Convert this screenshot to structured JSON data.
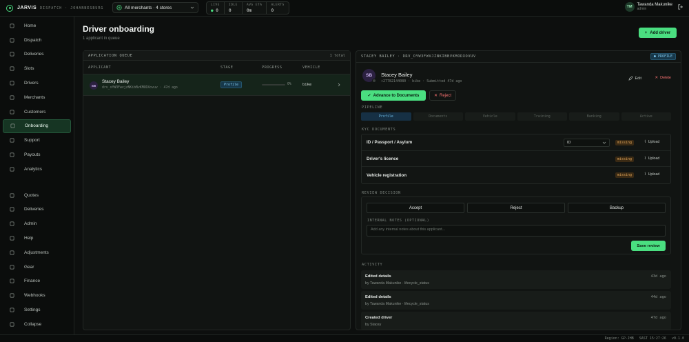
{
  "brand": {
    "name": "JARVIS",
    "sub": "DISPATCH · JOHANNESBURG"
  },
  "merchant_selector": {
    "label": "All merchants · 4 stores"
  },
  "stats": [
    {
      "label": "LIVE",
      "value": "0"
    },
    {
      "label": "IDLE",
      "value": "0"
    },
    {
      "label": "AVG ETA",
      "value": "0m"
    },
    {
      "label": "ALERTS",
      "value": "0"
    }
  ],
  "user": {
    "initials": "TM",
    "name": "Tawanda Makunike",
    "role": "admin"
  },
  "sidebar": {
    "items": [
      {
        "label": "Home",
        "icon": "home-icon"
      },
      {
        "label": "Dispatch",
        "icon": "map-icon"
      },
      {
        "label": "Deliveries",
        "icon": "box-icon"
      },
      {
        "label": "Slots",
        "icon": "clock-icon"
      },
      {
        "label": "Drivers",
        "icon": "users-icon"
      },
      {
        "label": "Merchants",
        "icon": "store-icon"
      },
      {
        "label": "Customers",
        "icon": "phone-icon"
      },
      {
        "label": "Onboarding",
        "icon": "check-circle-icon"
      },
      {
        "label": "Support",
        "icon": "support-icon"
      },
      {
        "label": "Payouts",
        "icon": "send-icon"
      },
      {
        "label": "Analytics",
        "icon": "bar-chart-icon"
      }
    ],
    "items2": [
      {
        "label": "Quotes",
        "icon": "document-icon"
      },
      {
        "label": "Deliveries",
        "icon": "box-icon"
      },
      {
        "label": "Admin",
        "icon": "shield-icon"
      },
      {
        "label": "Help",
        "icon": "help-icon"
      },
      {
        "label": "Adjustments",
        "icon": "adjust-icon"
      },
      {
        "label": "Gear",
        "icon": "gear-icon"
      },
      {
        "label": "Finance",
        "icon": "finance-icon"
      },
      {
        "label": "Webhooks",
        "icon": "webhook-icon"
      },
      {
        "label": "Settings",
        "icon": "settings-icon"
      },
      {
        "label": "Collapse",
        "icon": "chevron-left-icon"
      }
    ]
  },
  "page": {
    "title": "Driver onboarding",
    "subtitle": "1 applicant in queue",
    "add_button": "Add driver"
  },
  "queue": {
    "title": "APPLICATION QUEUE",
    "count": "1 total",
    "columns": [
      "APPLICANT",
      "STAGE",
      "PROGRESS",
      "VEHICLE"
    ],
    "rows": [
      {
        "initials": "SB",
        "name": "Stacey Bailey",
        "id": "drv_oYW3FwvjzNKibBvKMODXovuv · 47d ago",
        "stage": "Profile",
        "progress": 0,
        "progress_label": "0%",
        "vehicle": "bike"
      }
    ]
  },
  "detail": {
    "header": "STACEY BAILEY · DRV_OYW3FWVJZNKIBBVKMODXOVUV",
    "badge": "PROFILE",
    "initials": "SB",
    "name": "Stacey Bailey",
    "meta": "+27782144080 · bike · Submitted 47d ago",
    "edit": "Edit",
    "delete": "Delete",
    "advance": "Advance to Documents",
    "reject": "Reject",
    "pipeline_label": "PIPELINE",
    "pipeline": [
      "Profile",
      "Documents",
      "Vehicle",
      "Training",
      "Banking",
      "Active"
    ],
    "kyc_label": "KYC DOCUMENTS",
    "kyc": [
      {
        "name": "ID / Passport / Asylum",
        "select": "ID",
        "status": "missing",
        "action": "Upload"
      },
      {
        "name": "Driver's licence",
        "status": "missing",
        "action": "Upload"
      },
      {
        "name": "Vehicle registration",
        "status": "missing",
        "action": "Upload"
      }
    ],
    "review_label": "REVIEW DECISION",
    "review_buttons": [
      "Accept",
      "Reject",
      "Backup"
    ],
    "notes_label": "INTERNAL NOTES (OPTIONAL)",
    "notes_placeholder": "Add any internal notes about this applicant...",
    "save": "Save review",
    "activity_label": "ACTIVITY",
    "activity": [
      {
        "title": "Edited details",
        "by": "by Tawanda Makunike · lifecycle_status",
        "time": "43d ago"
      },
      {
        "title": "Edited details",
        "by": "by Tawanda Makunike · lifecycle_status",
        "time": "44d ago"
      },
      {
        "title": "Created driver",
        "by": "by Stacey",
        "time": "47d ago"
      }
    ]
  },
  "footer": {
    "region": "Region: GP-JHB",
    "time": "SAST 15:27:26",
    "version": "v0.1.0"
  },
  "colors": {
    "accent": "#4ade80",
    "danger": "#f87171",
    "info": "#6cb8e0",
    "warning": "#e0a458"
  }
}
